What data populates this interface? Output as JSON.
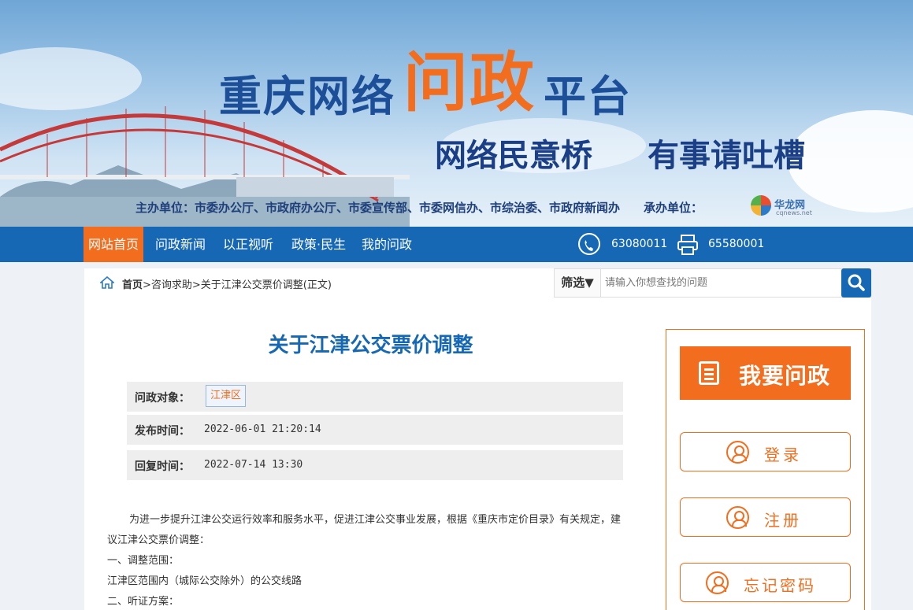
{
  "banner": {
    "title_a": "重庆网络",
    "title_b": "问政",
    "title_c": "平台",
    "slogan_1": "网络民意桥",
    "slogan_2": "有事请吐槽",
    "sponsor": "主办单位：市委办公厅、市政府办公厅、市委宣传部、市委网信办、市综治委、市政府新闻办　　承办单位：",
    "partner_name": "华龙网",
    "partner_domain": "cqnews.net"
  },
  "nav": {
    "items": [
      "网站首页",
      "问政新闻",
      "以正视听",
      "政策·民生",
      "我的问政"
    ],
    "phone": "63080011",
    "fax": "65580001"
  },
  "breadcrumb": {
    "home": "首页",
    "rest": ">咨询求助>关于江津公交票价调整(正文)"
  },
  "search": {
    "filter_label": "筛选▼",
    "placeholder": "请输入你想查找的问题"
  },
  "article": {
    "title": "关于江津公交票价调整",
    "target_label": "问政对象：",
    "target_value": "江津区",
    "publish_label": "发布时间：",
    "publish_value": "2022-06-01 21:20:14",
    "reply_label": "回复时间：",
    "reply_value": "2022-07-14 13:30",
    "paragraph_1": "为进一步提升江津公交运行效率和服务水平，促进江津公交事业发展，根据《重庆市定价目录》有关规定，建议江津公交票价调整：",
    "line_2": "一、调整范围：",
    "line_3": "江津区范围内（城际公交除外）的公交线路",
    "line_4": "二、听证方案："
  },
  "side": {
    "ask": "我要问政",
    "login": "登录",
    "register": "注册",
    "forgot": "忘记密码"
  },
  "colors": {
    "brand_blue": "#1668b5",
    "accent_orange": "#f36d1e"
  }
}
